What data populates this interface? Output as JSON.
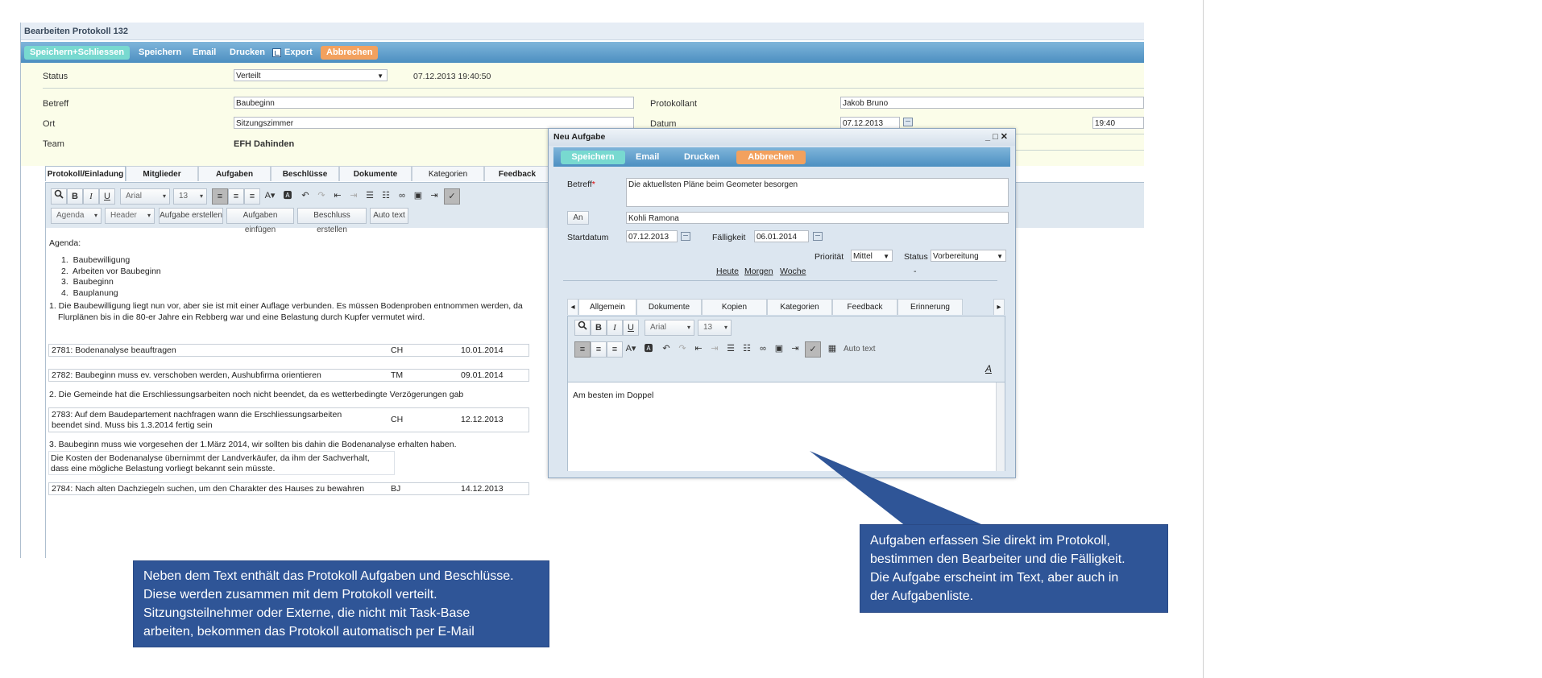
{
  "window": {
    "title": "Bearbeiten Protokoll 132"
  },
  "toolbar": {
    "save_close": "Speichern+Schliessen",
    "save": "Speichern",
    "email": "Email",
    "print": "Drucken",
    "export": "Export",
    "cancel": "Abbrechen"
  },
  "form": {
    "status_label": "Status",
    "status_value": "Verteilt",
    "timestamp": "07.12.2013 19:40:50",
    "subject_label": "Betreff",
    "subject_value": "Baubeginn",
    "place_label": "Ort",
    "place_value": "Sitzungszimmer",
    "team_label": "Team",
    "team_value": "EFH Dahinden",
    "author_label": "Protokollant",
    "author_value": "Jakob Bruno",
    "date_label": "Datum",
    "date_value": "07.12.2013",
    "time_value": "19:40"
  },
  "tabs": [
    "Protokoll/Einladung",
    "Mitglieder",
    "Aufgaben",
    "Beschlüsse",
    "Dokumente",
    "Kategorien",
    "Feedback"
  ],
  "editor": {
    "font": "Arial",
    "size": "13",
    "agenda_dd": "Agenda",
    "header_dd": "Header",
    "btn_create_task": "Aufgabe erstellen",
    "btn_insert_tasks": "Aufgaben einfügen",
    "btn_create_decision": "Beschluss erstellen",
    "btn_auto_text": "Auto text"
  },
  "document": {
    "agenda_title": "Agenda:",
    "agenda_items": [
      "Baubewilligung",
      "Arbeiten vor Baubeginn",
      "Baubeginn",
      "Bauplanung"
    ],
    "para1_line1": "1. Die Baubewilligung liegt nun vor, aber sie ist mit einer Auflage verbunden. Es müssen Bodenproben entnommen werden, da",
    "para1_line2": "Flurplänen bis in die 80-er Jahre ein Rebberg war und eine Belastung durch Kupfer vermutet wird.",
    "task1": {
      "text": "2781: Bodenanalyse beauftragen",
      "who": "CH",
      "due": "10.01.2014"
    },
    "task2": {
      "text": "2782: Baubeginn muss ev. verschoben werden, Aushubfirma orientieren",
      "who": "TM",
      "due": "09.01.2014"
    },
    "para2": "2. Die Gemeinde hat die Erschliessungsarbeiten noch nicht beendet, da es wetterbedingte Verzögerungen gab",
    "task3": {
      "line1": "2783: Auf dem Baudepartement nachfragen wann die Erschliessungsarbeiten",
      "line2": "beendet sind. Muss bis 1.3.2014 fertig sein",
      "who": "CH",
      "due": "12.12.2013"
    },
    "para3": "3. Baubeginn muss wie vorgesehen der 1.März 2014, wir sollten bis dahin die Bodenanalyse erhalten haben.",
    "decision_line1": "Die Kosten der Bodenanalyse übernimmt der Landverkäufer, da ihm der Sachverhalt,",
    "decision_line2": "dass eine mögliche Belastung vorliegt bekannt sein müsste.",
    "task4": {
      "text": "2784: Nach alten Dachziegeln suchen, um den Charakter des Hauses zu bewahren",
      "who": "BJ",
      "due": "14.12.2013"
    }
  },
  "dialog": {
    "title": "Neu Aufgabe",
    "toolbar": {
      "save": "Speichern",
      "email": "Email",
      "print": "Drucken",
      "cancel": "Abbrechen"
    },
    "subject_label": "Betreff",
    "required_mark": "*",
    "subject_value": "Die aktuellsten Pläne beim Geometer besorgen",
    "to_button": "An",
    "to_value": "Kohli Ramona",
    "start_label": "Startdatum",
    "start_value": "07.12.2013",
    "due_label": "Fälligkeit",
    "due_value": "06.01.2014",
    "priority_label": "Priorität",
    "priority_value": "Mittel",
    "status_label": "Status",
    "status_value": "Vorbereitung",
    "quick_today": "Heute",
    "quick_tomorrow": "Morgen",
    "quick_week": "Woche",
    "dash": "-",
    "tabs": [
      "Allgemein",
      "Dokumente",
      "Kopien",
      "Kategorien",
      "Feedback",
      "Erinnerung"
    ],
    "font": "Arial",
    "size": "13",
    "auto_text": "Auto text",
    "body": "Am besten im Doppel"
  },
  "callouts": {
    "left": [
      "Neben dem Text enthält das Protokoll Aufgaben und Beschlüsse.",
      "Diese werden zusammen mit dem Protokoll verteilt.",
      "Sitzungsteilnehmer oder Externe, die nicht mit Task-Base",
      "arbeiten, bekommen das Protokoll automatisch per E-Mail"
    ],
    "right": [
      "Aufgaben erfassen Sie direkt im Protokoll,",
      "bestimmen den Bearbeiter und die Fälligkeit.",
      "Die Aufgabe erscheint im Text, aber auch in",
      "der Aufgabenliste."
    ]
  },
  "colors": {
    "callout": "#2f5597",
    "toolbar": "#4c8fc1",
    "green_btn": "#78d9d0",
    "orange_btn": "#f3a15e",
    "form_bg": "#fbfde9"
  }
}
